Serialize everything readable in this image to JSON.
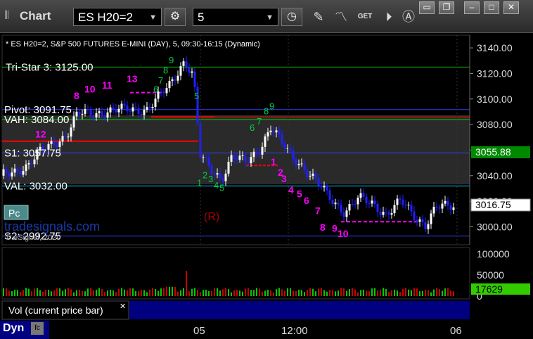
{
  "window": {
    "title": "Chart",
    "symbol": "ES H20=2",
    "interval": "5",
    "get_label": "GET"
  },
  "chart_data": {
    "type": "candlestick",
    "header": "* ES H20=2, S&P 500 FUTURES E-MINI (DAY), 5, 09:30-16:15 (Dynamic)",
    "ylim": [
      2992,
      3145
    ],
    "price_ticks": [
      "3140.00",
      "3120.00",
      "3100.00",
      "3080.00",
      "3060.00",
      "3040.00",
      "3020.00",
      "3000.00"
    ],
    "price_tick_values": [
      3140,
      3120,
      3100,
      3080,
      3060,
      3040,
      3020,
      3000
    ],
    "time_labels": [
      "05",
      "12:00",
      "06"
    ],
    "current_price": "3016.75",
    "reference_price": "3055.88",
    "levels": [
      {
        "label": "Tri-Star 3: 3125.00",
        "value": 3125.0
      },
      {
        "label": "Pivot: 3091.75",
        "value": 3091.75
      },
      {
        "label": "VAH: 3084.00",
        "value": 3084.0
      },
      {
        "label": "S1: 3057.75",
        "value": 3057.75
      },
      {
        "label": "VAL: 3032.00",
        "value": 3032.0
      },
      {
        "label": "S2: 2992.75",
        "value": 2992.75
      }
    ],
    "watermark": "© eSignal, 2020",
    "site": "tradesignals.com",
    "badge": "Pc",
    "reversal_mark": "(R)",
    "volume": {
      "ticks": [
        "100000",
        "50000",
        "0"
      ],
      "tick_values": [
        100000,
        50000,
        0
      ],
      "current": "17629",
      "label": "Vol (current price bar)"
    },
    "counts_magenta": [
      "8",
      "10",
      "11",
      "13",
      "12",
      "1",
      "2",
      "3",
      "4",
      "5",
      "6",
      "7",
      "8",
      "9",
      "10",
      "13"
    ],
    "counts_green": [
      "9",
      "8",
      "7",
      "6",
      "5",
      "1",
      "2",
      "3",
      "4",
      "5",
      "6",
      "7",
      "8",
      "9"
    ]
  },
  "status": {
    "mode": "Dyn"
  },
  "colors": {
    "up": "#ffffff",
    "down": "#2020ff",
    "pivot": "#3040ff",
    "vah": "#00cc00",
    "val": "#00ccff",
    "tristar": "#00bb00",
    "red_level": "#ff0000",
    "magenta": "#ff00ff",
    "green_count": "#00cc44"
  }
}
